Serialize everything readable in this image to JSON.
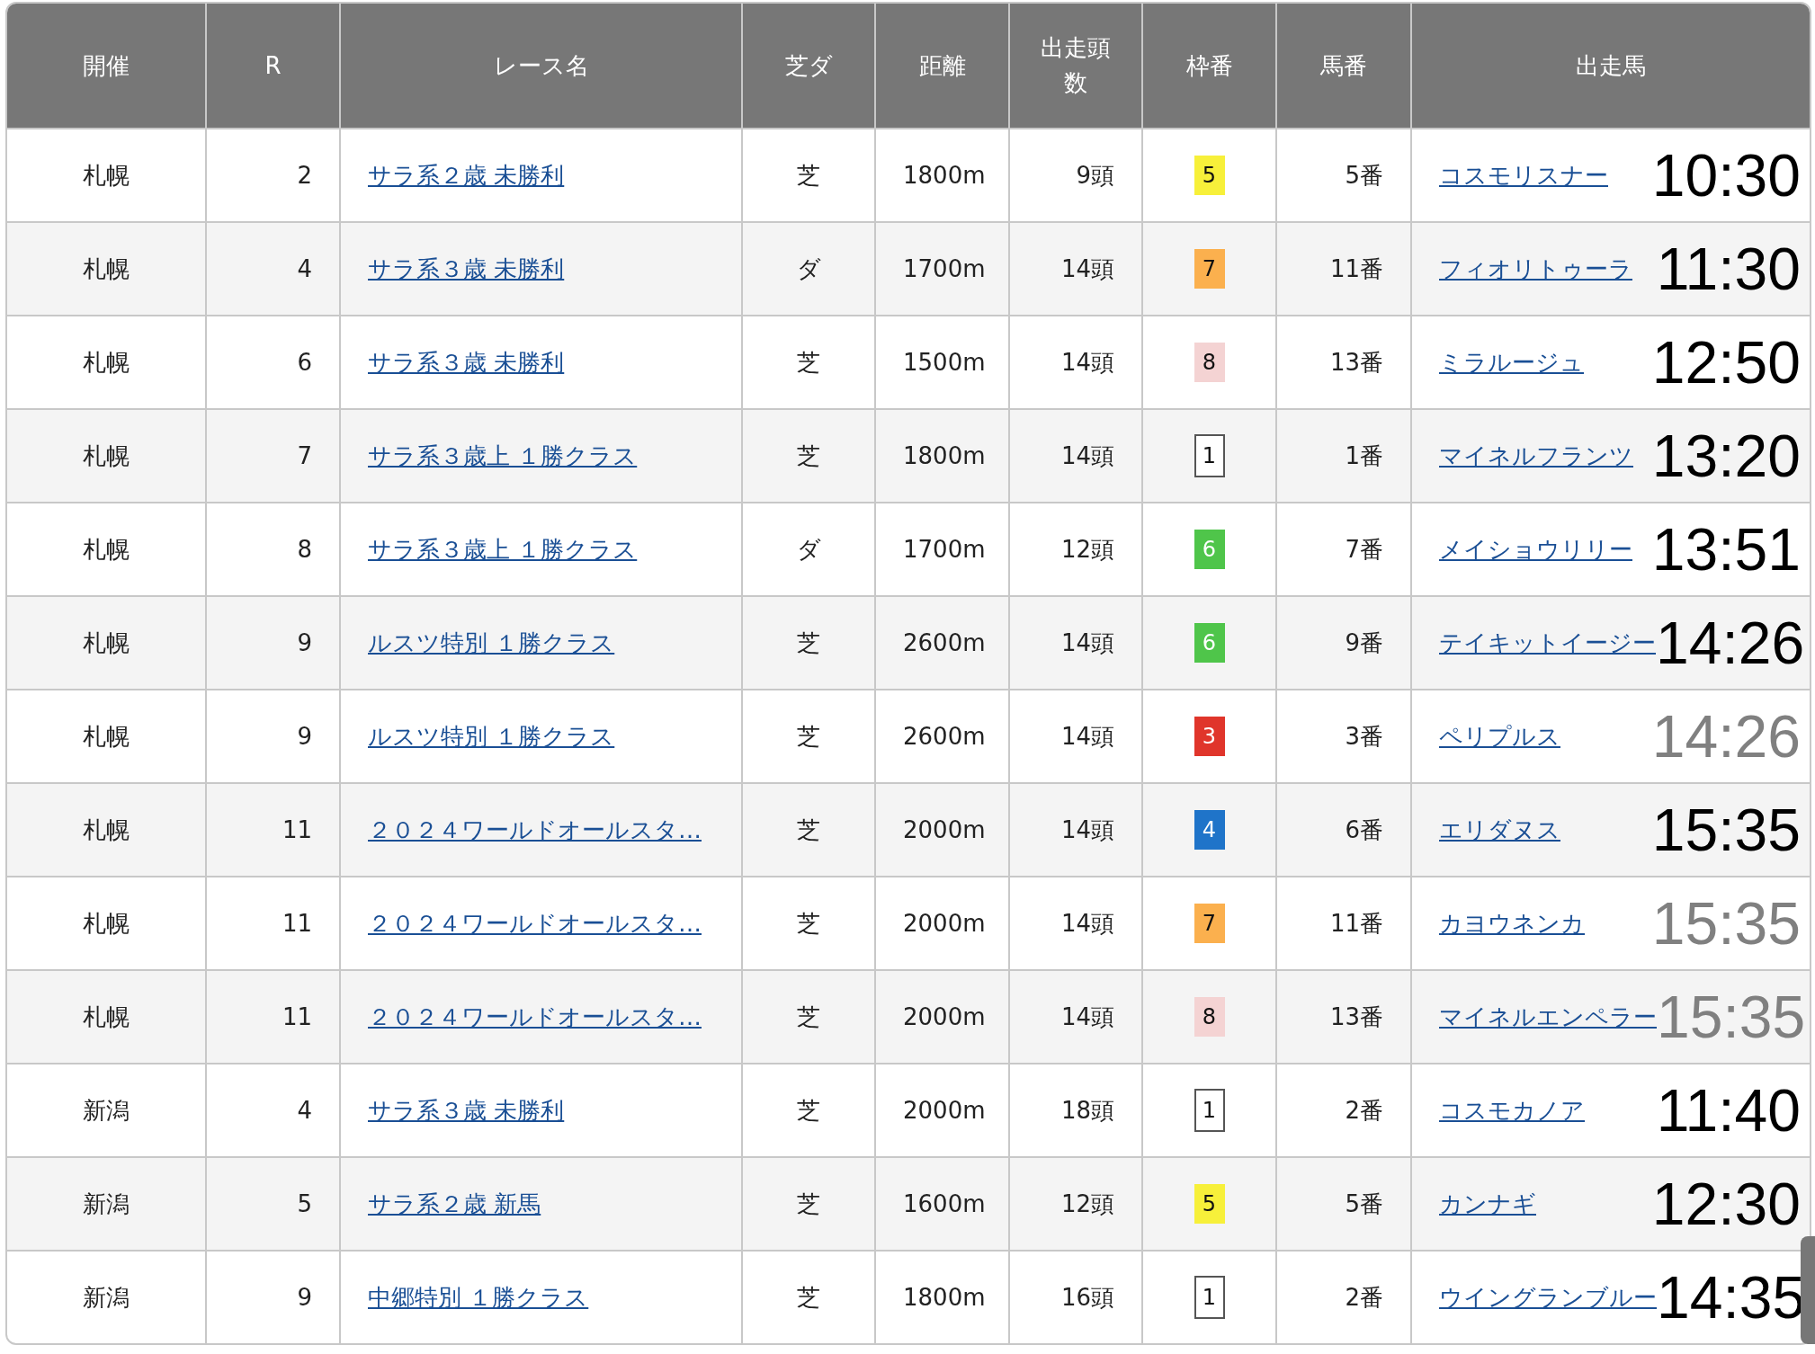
{
  "table": {
    "columns": [
      "開催",
      "R",
      "レース名",
      "芝ダ",
      "距離",
      "出走頭数",
      "枠番",
      "馬番",
      "出走馬"
    ],
    "rows": [
      {
        "venue": "札幌",
        "race": "2",
        "race_name": "サラ系２歳 未勝利",
        "surface": "芝",
        "distance": "1800m",
        "runners": "9頭",
        "frame": {
          "label": "5",
          "color": "#f7f03a"
        },
        "number": "5番",
        "horse": "コスモリスナー",
        "time": "10:30",
        "dimmed": false
      },
      {
        "venue": "札幌",
        "race": "4",
        "race_name": "サラ系３歳 未勝利",
        "surface": "ダ",
        "distance": "1700m",
        "runners": "14頭",
        "frame": {
          "label": "7",
          "color": "#fbb04e"
        },
        "number": "11番",
        "horse": "フィオリトゥーラ",
        "time": "11:30",
        "dimmed": false
      },
      {
        "venue": "札幌",
        "race": "6",
        "race_name": "サラ系３歳 未勝利",
        "surface": "芝",
        "distance": "1500m",
        "runners": "14頭",
        "frame": {
          "label": "8",
          "color": "#f4d3d3"
        },
        "number": "13番",
        "horse": "ミラルージュ",
        "time": "12:50",
        "dimmed": false
      },
      {
        "venue": "札幌",
        "race": "7",
        "race_name": "サラ系３歳上 １勝クラス",
        "surface": "芝",
        "distance": "1800m",
        "runners": "14頭",
        "frame": {
          "label": "1",
          "color": "#ffffff"
        },
        "number": "1番",
        "horse": "マイネルフランツ",
        "time": "13:20",
        "dimmed": false
      },
      {
        "venue": "札幌",
        "race": "8",
        "race_name": "サラ系３歳上 １勝クラス",
        "surface": "ダ",
        "distance": "1700m",
        "runners": "12頭",
        "frame": {
          "label": "6",
          "color": "#4fc54a"
        },
        "number": "7番",
        "horse": "メイショウリリー",
        "time": "13:51",
        "dimmed": false
      },
      {
        "venue": "札幌",
        "race": "9",
        "race_name": "ルスツ特別 １勝クラス",
        "surface": "芝",
        "distance": "2600m",
        "runners": "14頭",
        "frame": {
          "label": "6",
          "color": "#4fc54a"
        },
        "number": "9番",
        "horse": "テイキットイージー",
        "time": "14:26",
        "dimmed": false
      },
      {
        "venue": "札幌",
        "race": "9",
        "race_name": "ルスツ特別 １勝クラス",
        "surface": "芝",
        "distance": "2600m",
        "runners": "14頭",
        "frame": {
          "label": "3",
          "color": "#e0352b"
        },
        "number": "3番",
        "horse": "ペリプルス",
        "time": "14:26",
        "dimmed": true
      },
      {
        "venue": "札幌",
        "race": "11",
        "race_name": "２０２４ワールドオールスタ…",
        "surface": "芝",
        "distance": "2000m",
        "runners": "14頭",
        "frame": {
          "label": "4",
          "color": "#1f74c9"
        },
        "number": "6番",
        "horse": "エリダヌス",
        "time": "15:35",
        "dimmed": false
      },
      {
        "venue": "札幌",
        "race": "11",
        "race_name": "２０２４ワールドオールスタ…",
        "surface": "芝",
        "distance": "2000m",
        "runners": "14頭",
        "frame": {
          "label": "7",
          "color": "#fbb04e"
        },
        "number": "11番",
        "horse": "カヨウネンカ",
        "time": "15:35",
        "dimmed": true
      },
      {
        "venue": "札幌",
        "race": "11",
        "race_name": "２０２４ワールドオールスタ…",
        "surface": "芝",
        "distance": "2000m",
        "runners": "14頭",
        "frame": {
          "label": "8",
          "color": "#f4d3d3"
        },
        "number": "13番",
        "horse": "マイネルエンペラー",
        "time": "15:35",
        "dimmed": true
      },
      {
        "venue": "新潟",
        "race": "4",
        "race_name": "サラ系３歳 未勝利",
        "surface": "芝",
        "distance": "2000m",
        "runners": "18頭",
        "frame": {
          "label": "1",
          "color": "#ffffff"
        },
        "number": "2番",
        "horse": "コスモカノア",
        "time": "11:40",
        "dimmed": false
      },
      {
        "venue": "新潟",
        "race": "5",
        "race_name": "サラ系２歳 新馬",
        "surface": "芝",
        "distance": "1600m",
        "runners": "12頭",
        "frame": {
          "label": "5",
          "color": "#f7f03a"
        },
        "number": "5番",
        "horse": "カンナギ",
        "time": "12:30",
        "dimmed": false
      },
      {
        "venue": "新潟",
        "race": "9",
        "race_name": "中郷特別 １勝クラス",
        "surface": "芝",
        "distance": "1800m",
        "runners": "16頭",
        "frame": {
          "label": "1",
          "color": "#ffffff"
        },
        "number": "2番",
        "horse": "ウイングランブルー",
        "time": "14:35",
        "dimmed": false
      }
    ]
  }
}
